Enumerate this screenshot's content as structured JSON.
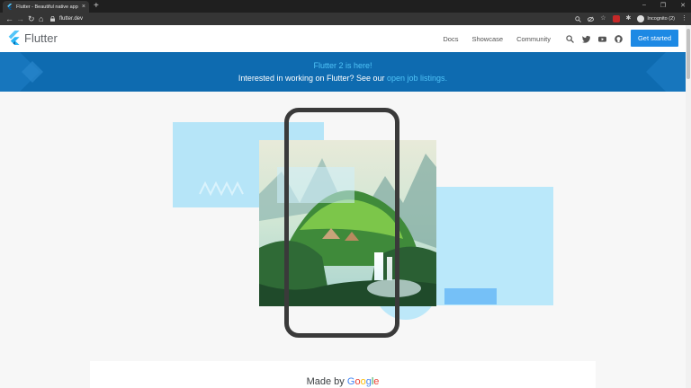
{
  "browser": {
    "tab_title": "Flutter - Beautiful native apps in...",
    "tab_close": "×",
    "new_tab": "+",
    "url": "flutter.dev",
    "back": "←",
    "forward": "→",
    "reload": "↻",
    "home": "⌂",
    "profile_label": "Incognito (2)",
    "window_minimize": "–",
    "window_restore": "❐",
    "window_close": "✕"
  },
  "header": {
    "logo_text": "Flutter",
    "nav": [
      "Docs",
      "Showcase",
      "Community"
    ],
    "cta": "Get started"
  },
  "banner": {
    "line1": "Flutter 2 is here!",
    "line2_prefix": "Interested in working on Flutter? See our ",
    "line2_link": "open job listings",
    "line2_suffix": "."
  },
  "footer_card": {
    "made_by": "Made by",
    "google": [
      "G",
      "o",
      "o",
      "g",
      "l",
      "e"
    ]
  },
  "colors": {
    "brand_blue": "#1d89e4",
    "banner_bg": "#0e6bb0",
    "banner_accent": "#4fc3f7",
    "card_light_blue": "#b3e5f9"
  },
  "icons": [
    "flutter-logo-icon",
    "search-icon",
    "twitter-icon",
    "youtube-icon",
    "github-icon",
    "lock-icon",
    "star-icon",
    "extensions-icon"
  ]
}
